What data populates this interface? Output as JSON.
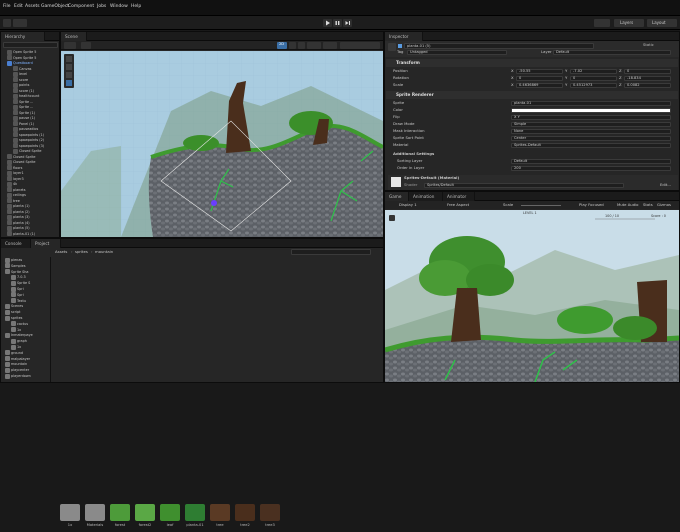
{
  "menu": [
    "File",
    "Edit",
    "Assets",
    "GameObject",
    "Component",
    "Jobs",
    "Window",
    "Help"
  ],
  "layers_label": "Layers",
  "layout_label": "Layout",
  "hierarchy": {
    "title": "Hierarchy",
    "items": [
      "Open Sprite 5",
      "Open Sprite 5",
      "Questboard",
      "Canvas",
      "level",
      "score",
      "points",
      "score (1)",
      "healthcount",
      "Sprite ...",
      "Sprite ...",
      "Sprite (1)",
      "pause (1)",
      "Panel (1)",
      "pauseadios",
      "spawpoints (1)",
      "spawpoints (2)",
      "spawpoints (3)",
      "Closed Sprite",
      "Closed Sprite",
      "Closed Sprite",
      "floors",
      "layer1",
      "layer3",
      "4k",
      "planets",
      "ceilings",
      "tree",
      "planta (1)",
      "planta (2)",
      "planta (3)",
      "planta (4)",
      "planta (5)",
      "planta-01 (1)"
    ]
  },
  "scene": {
    "tab": "Scene",
    "mode": "2D"
  },
  "inspector": {
    "title": "Inspector",
    "object_name": "planta-01 (5)",
    "static_label": "Static",
    "tag_label": "Tag",
    "tag_value": "Untagged",
    "layer_label": "Layer",
    "layer_value": "Default",
    "transform": {
      "title": "Transform",
      "position_label": "Position",
      "rotation_label": "Rotation",
      "scale_label": "Scale",
      "position": [
        "-50.55",
        "-7.02",
        "0"
      ],
      "rotation": [
        "0",
        "0",
        "-18.834"
      ],
      "scale": [
        "0.4636869",
        "0.4512973",
        "0.0082"
      ]
    },
    "sprite_renderer": {
      "title": "Sprite Renderer",
      "rows": [
        {
          "label": "Sprite",
          "value": "planta-01"
        },
        {
          "label": "Color",
          "value": ""
        },
        {
          "label": "Flip",
          "value": "X   Y"
        },
        {
          "label": "Draw Mode",
          "value": "Simple"
        },
        {
          "label": "Mask Interaction",
          "value": "None"
        },
        {
          "label": "Sprite Sort Point",
          "value": "Center"
        },
        {
          "label": "Material",
          "value": "Sprites-Default"
        }
      ],
      "additional": "Additional Settings",
      "sorting_layer_label": "Sorting Layer",
      "sorting_layer": "Default",
      "order_label": "Order in Layer",
      "order": "200"
    },
    "material": {
      "name": "Sprites-Default (Material)",
      "shader_label": "Shader",
      "shader": "Sprites/Default",
      "edit": "Edit..."
    }
  },
  "game": {
    "tabs": [
      "Game",
      "Animation",
      "Animator"
    ],
    "display": "Display 1",
    "aspect": "Free Aspect",
    "scale_label": "Scale",
    "play_mode": "Play Focused",
    "mute": "Mute Audio",
    "stats": "Stats",
    "gizmos": "Gizmos",
    "hud_level": "LEVEL 1",
    "hud_health": "100 / 10",
    "hud_score": "Score : 0"
  },
  "console_tab": "Console",
  "project_tab": "Project",
  "project_tree": [
    "pienas",
    "Samples",
    "Sprite Sha",
    "7.0.3",
    "Sprite S",
    "Spri",
    "Spri",
    "Textu",
    "Scenes",
    "script",
    "sprites",
    "cactus",
    "1x",
    "Inmaterpaye",
    "graph",
    "1x",
    "ground",
    "malpalayer",
    "mountain",
    "playcenter",
    "playerdown"
  ],
  "breadcrumb": [
    "Assets",
    "sprites",
    "mountain"
  ],
  "assets": [
    "1x",
    "Materials",
    "forest",
    "forest2",
    "leaf",
    "planta-01",
    "tree",
    "tree2",
    "tree3"
  ]
}
